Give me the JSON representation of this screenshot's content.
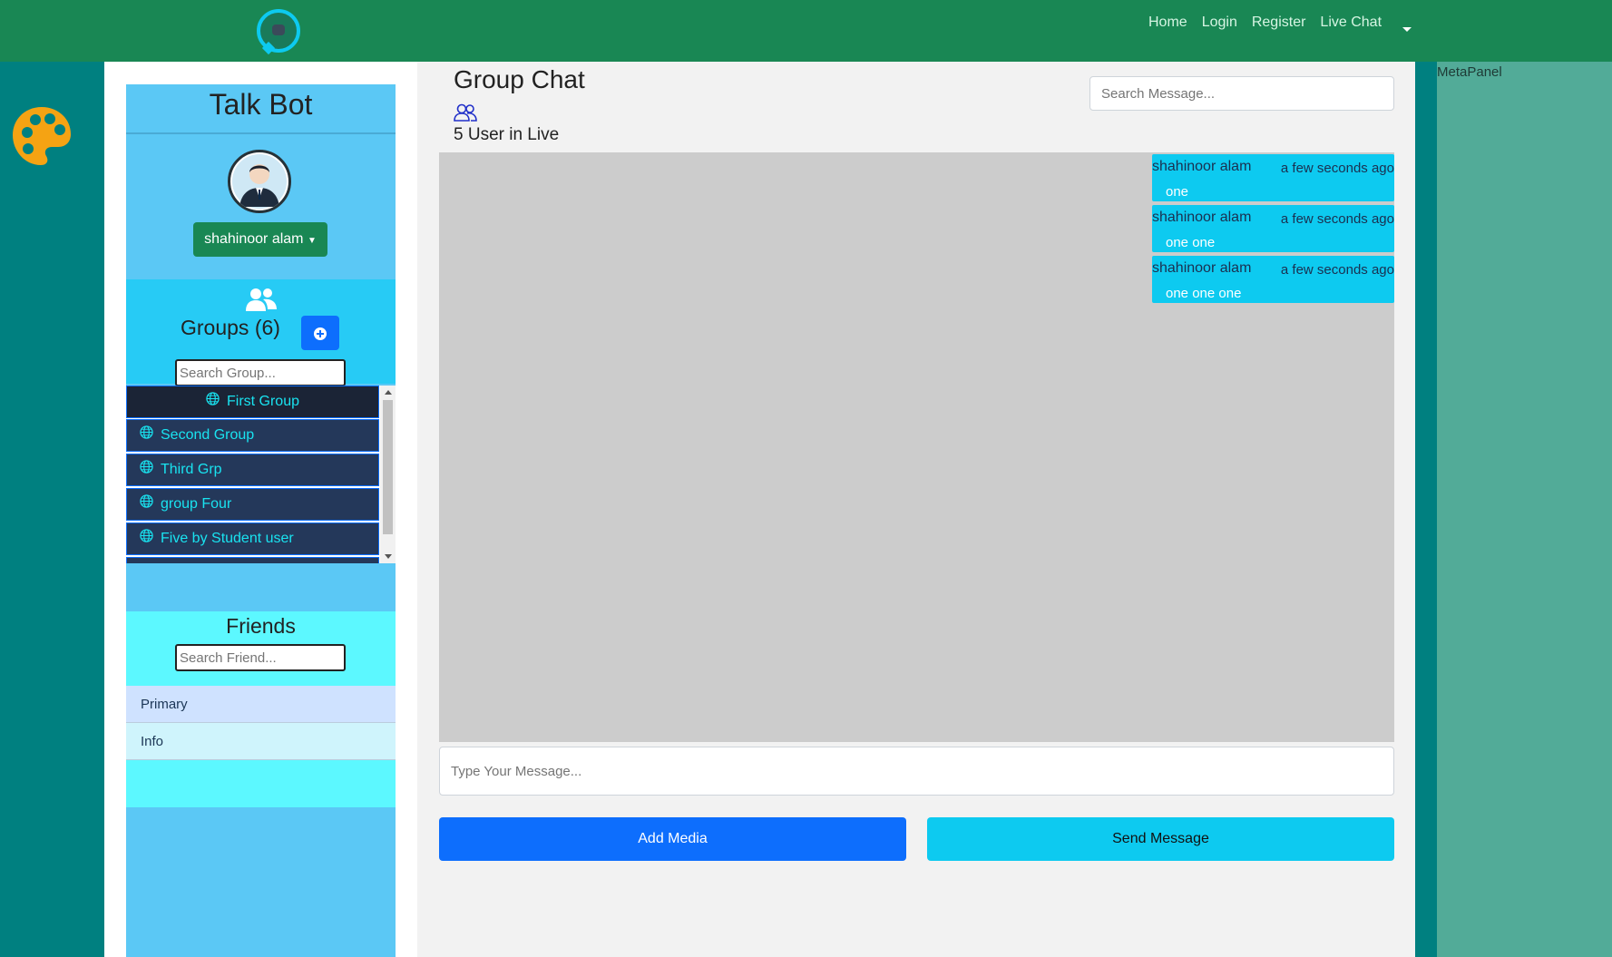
{
  "nav": {
    "links": [
      "Home",
      "Login",
      "Register",
      "Live Chat"
    ]
  },
  "sidebar": {
    "title": "Talk Bot",
    "user_button": "shahinoor alam",
    "groups": {
      "title": "Groups (6)",
      "search_placeholder": "Search Group...",
      "items": [
        "First Group",
        "Second Group",
        "Third Grp",
        "group Four",
        "Five by Student user"
      ]
    },
    "friends": {
      "title": "Friends",
      "search_placeholder": "Search Friend...",
      "items": [
        "Primary",
        "Info"
      ]
    }
  },
  "main": {
    "title": "Group Chat",
    "live_count": "5 User in Live",
    "search_placeholder": "Search Message...",
    "messages": [
      {
        "sender": "shahinoor alam",
        "time": "a few seconds ago",
        "text": "one"
      },
      {
        "sender": "shahinoor alam",
        "time": "a few seconds ago",
        "text": "one one"
      },
      {
        "sender": "shahinoor alam",
        "time": "a few seconds ago",
        "text": "one one one"
      }
    ],
    "input_placeholder": "Type Your Message...",
    "add_media_label": "Add Media",
    "send_label": "Send Message"
  },
  "right_panel": {
    "label": "MetaPanel"
  },
  "colors": {
    "navbar": "#198754",
    "page_bg": "#008080",
    "sidebar": "#5bc8f5",
    "groups_bg": "#27cbf5",
    "friends_bg": "#5cf8ff",
    "accent_blue": "#0d6efd",
    "accent_cyan": "#0dcaf0",
    "right_panel": "#52ab98"
  }
}
